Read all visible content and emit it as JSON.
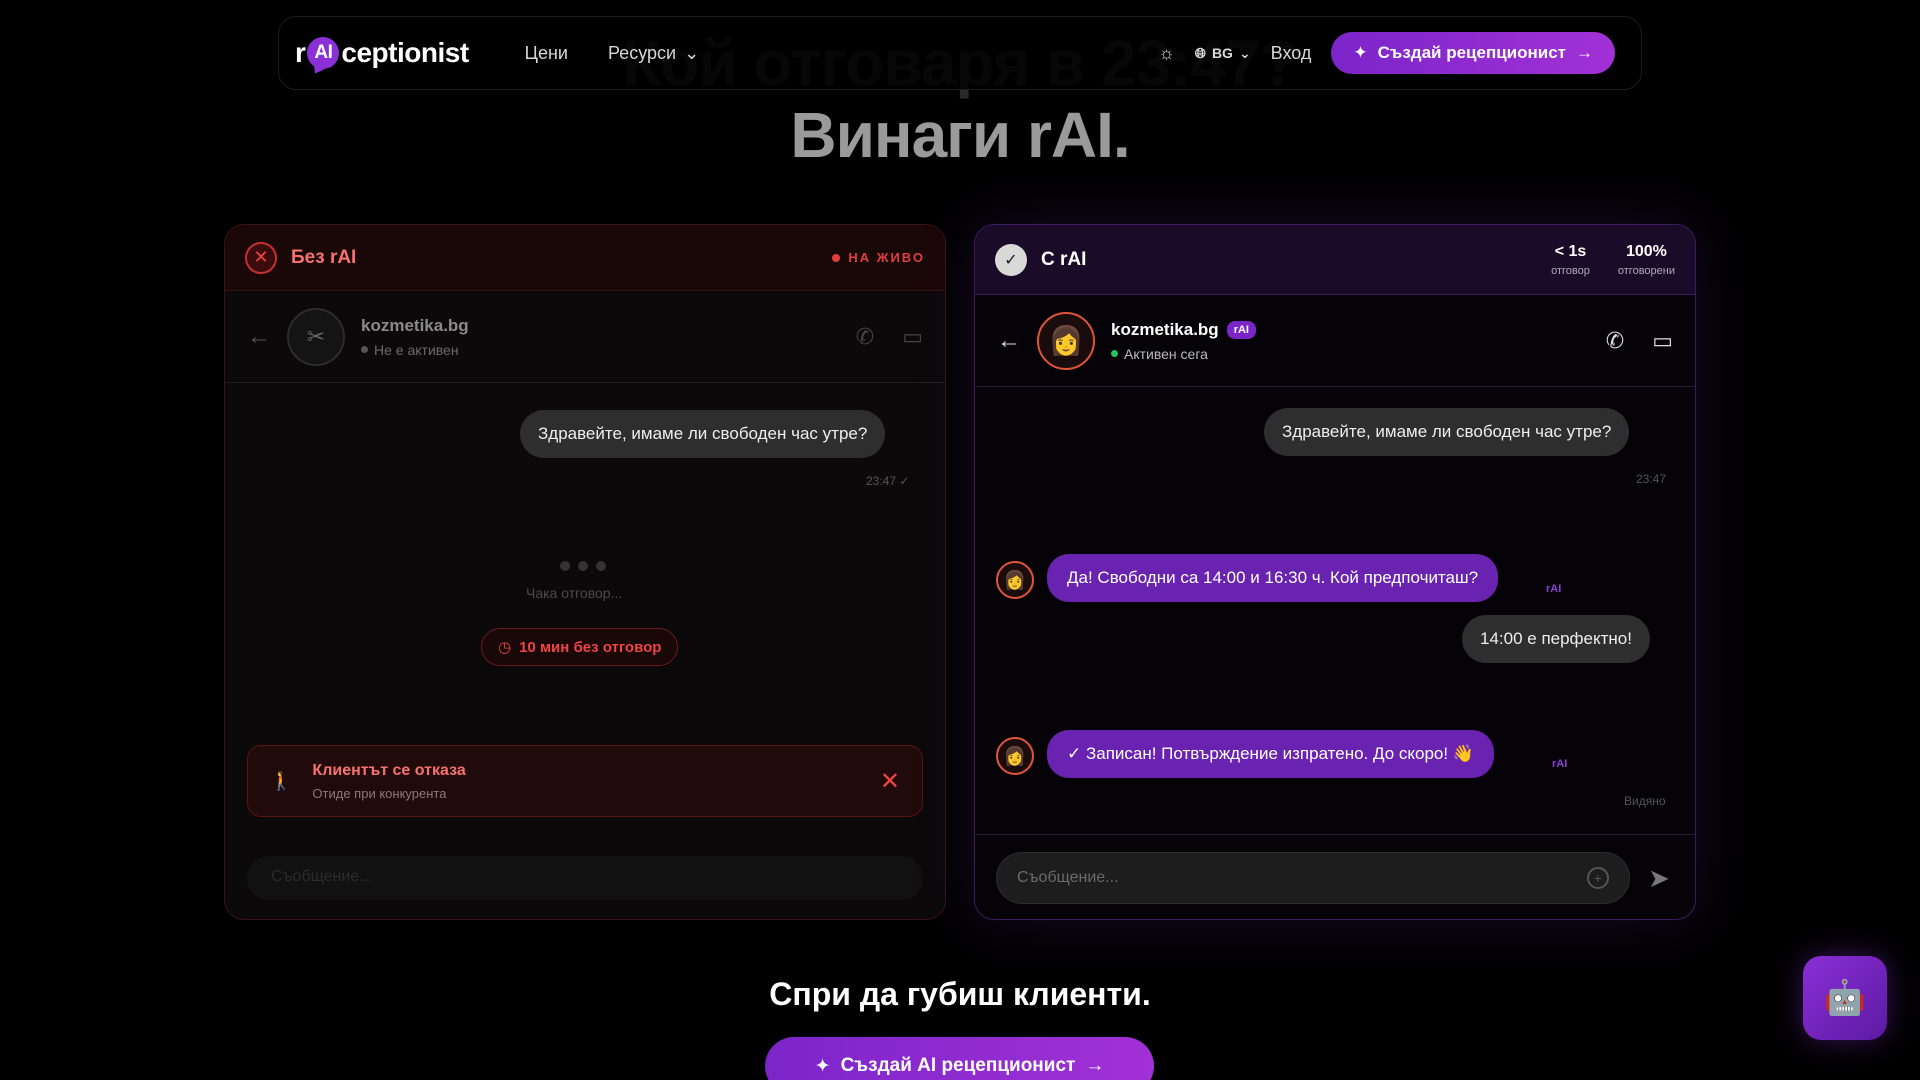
{
  "headline": {
    "line1": "Кой отговаря в 23:47?",
    "line2": "Винаги rAI."
  },
  "nav": {
    "logo_prefix": "r",
    "logo_ai": "AI",
    "logo_suffix": "ceptionist",
    "pricing": "Цени",
    "resources": "Ресурси",
    "lang": "BG",
    "login": "Вход",
    "cta": "Създай рецепционист"
  },
  "left_panel": {
    "title": "Без rAI",
    "live": "НА ЖИВО",
    "contact_name": "kozmetika.bg",
    "contact_status": "Не е активен",
    "message": "Здравейте, имаме ли свободен час утре?",
    "message_time": "23:47",
    "waiting": "Чака отговор...",
    "timer": "10 мин без отговор",
    "alert_title": "Клиентът се отказа",
    "alert_sub": "Отиде при конкурента",
    "input_placeholder": "Съобщение..."
  },
  "right_panel": {
    "title": "С rAI",
    "stat1_value": "< 1s",
    "stat1_label": "отговор",
    "stat2_value": "100%",
    "stat2_label": "отговорени",
    "contact_name": "kozmetika.bg",
    "contact_tag": "rAI",
    "contact_status": "Активен сега",
    "msg1": "Здравейте, имаме ли свободен час утре?",
    "msg1_time": "23:47",
    "ai1": "Да! Свободни са 14:00 и 16:30 ч. Кой предпочиташ?",
    "ai1_tag": "rAI",
    "msg2": "14:00 е перфектно!",
    "ai2": "✓ Записан! Потвърждение изпратено. До скоро! 👋",
    "ai2_tag": "rAI",
    "seen": "Видяно",
    "input_placeholder": "Съобщение..."
  },
  "footer": {
    "tagline": "Спри да губиш клиенти.",
    "cta": "Създай AI рецепционист"
  },
  "colors": {
    "accent": "#7b25c9",
    "danger": "#ef4444",
    "online": "#22c55e"
  }
}
